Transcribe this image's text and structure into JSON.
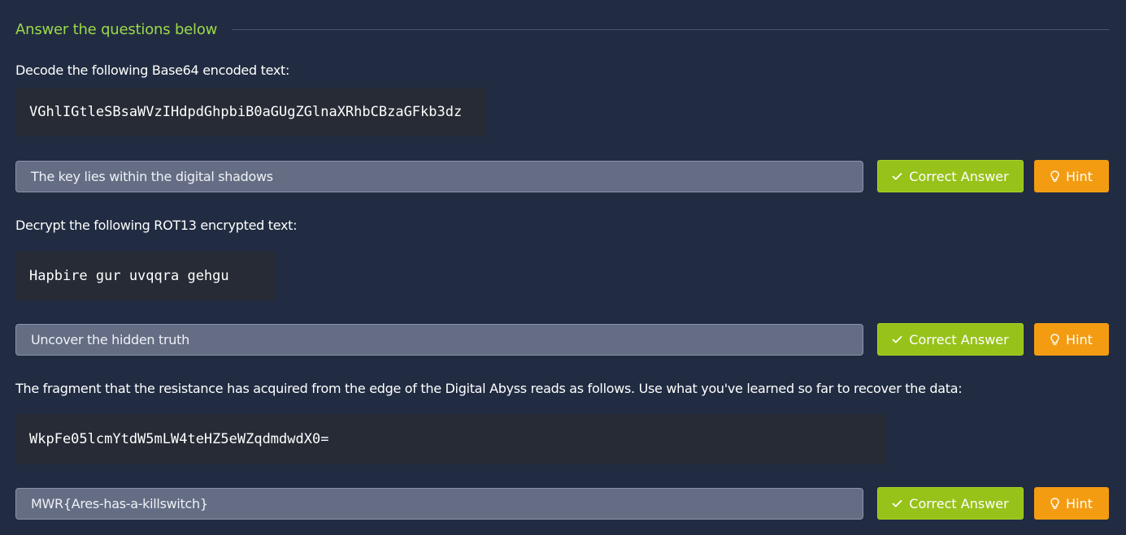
{
  "section": {
    "title": "Answer the questions below"
  },
  "questions": [
    {
      "prompt": "Decode the following Base64 encoded text:",
      "code": "VGhlIGtleSBsaWVzIHdpdGhpbiB0aGUgZGlnaXRhbCBzaGFkb3dz",
      "answer": "The key lies within the digital shadows",
      "submit_label": "Correct Answer",
      "hint_label": "Hint"
    },
    {
      "prompt": "Decrypt the following ROT13 encrypted text:",
      "code": "Hapbire gur uvqqra gehgu",
      "answer": "Uncover the hidden truth",
      "submit_label": "Correct Answer",
      "hint_label": "Hint"
    },
    {
      "prompt": "The fragment that the resistance has acquired from the edge of the Digital Abyss reads as follows. Use what you've learned so far to recover the data:",
      "code": "WkpFe05lcmYtdW5mLW4teHZ5eWZqdmdwdX0=",
      "answer": "MWR{Ares-has-a-killswitch}",
      "submit_label": "Correct Answer",
      "hint_label": "Hint"
    }
  ],
  "icons": {
    "submit": "check-icon",
    "hint": "lightbulb-icon"
  },
  "colors": {
    "background": "#212c42",
    "section_title": "#9cd94a",
    "code_background": "#262b35",
    "answer_field": "#646d83",
    "correct_button": "#97c21a",
    "hint_button": "#f39c12"
  }
}
